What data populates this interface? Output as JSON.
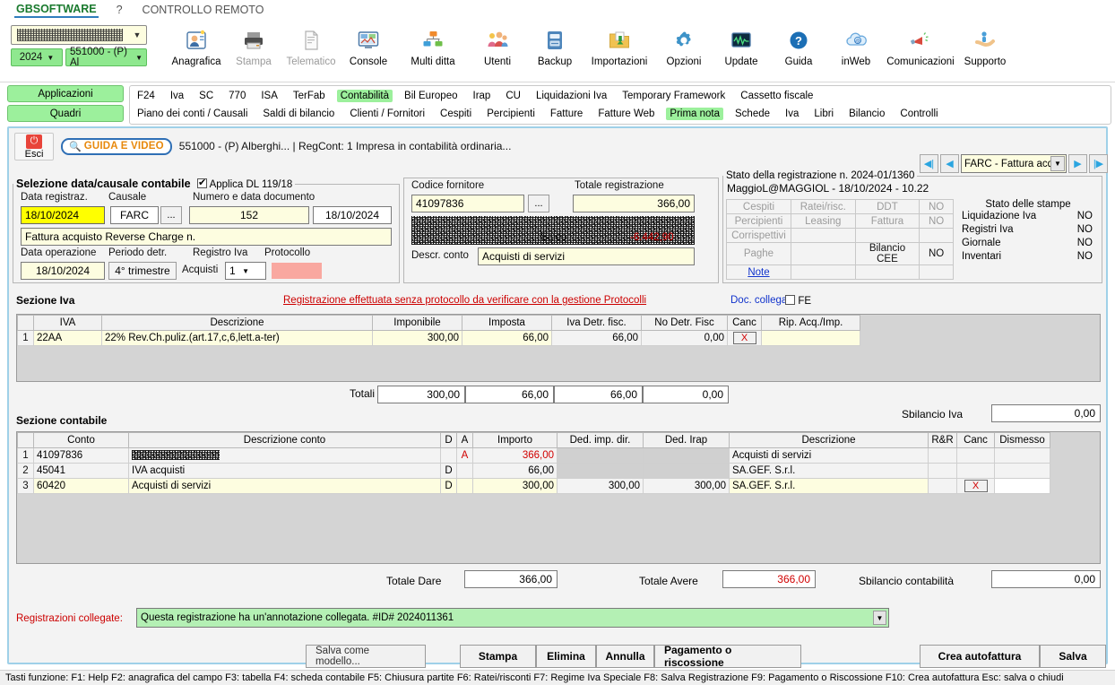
{
  "menubar": {
    "items": [
      {
        "label": "GBSOFTWARE",
        "active": true
      },
      {
        "label": "?",
        "active": false
      },
      {
        "label": "CONTROLLO REMOTO",
        "active": false
      }
    ]
  },
  "company": {
    "year": "2024",
    "code": "551000 - (P) Al",
    "name_redacted": ""
  },
  "toolbar": {
    "items": [
      {
        "label": "Anagrafica",
        "icon": "id-card-icon",
        "dim": false
      },
      {
        "label": "Stampa",
        "icon": "printer-icon",
        "dim": true
      },
      {
        "label": "Telematico",
        "icon": "document-icon",
        "dim": true
      },
      {
        "label": "Console",
        "icon": "monitor-icon",
        "dim": false
      },
      {
        "label": "Multi ditta",
        "icon": "org-chart-icon",
        "dim": false
      },
      {
        "label": "Utenti",
        "icon": "users-icon",
        "dim": false
      },
      {
        "label": "Backup",
        "icon": "backup-icon",
        "dim": false
      },
      {
        "label": "Importazioni",
        "icon": "import-folder-icon",
        "dim": false
      },
      {
        "label": "Opzioni",
        "icon": "gear-icon",
        "dim": false
      },
      {
        "label": "Update",
        "icon": "update-monitor-icon",
        "dim": false
      },
      {
        "label": "Guida",
        "icon": "help-icon",
        "dim": false
      },
      {
        "label": "inWeb",
        "icon": "cloud-icon",
        "dim": false
      },
      {
        "label": "Comunicazioni",
        "icon": "megaphone-icon",
        "dim": false
      },
      {
        "label": "Supporto",
        "icon": "support-hand-icon",
        "dim": false
      }
    ]
  },
  "nav": {
    "left_buttons": [
      "Applicazioni",
      "Quadri"
    ],
    "row1": [
      {
        "label": "F24",
        "selected": false
      },
      {
        "label": "Iva",
        "selected": false
      },
      {
        "label": "SC",
        "selected": false
      },
      {
        "label": "770",
        "selected": false
      },
      {
        "label": "ISA",
        "selected": false
      },
      {
        "label": "TerFab",
        "selected": false
      },
      {
        "label": "Contabilità",
        "selected": true
      },
      {
        "label": "Bil Europeo",
        "selected": false
      },
      {
        "label": "Irap",
        "selected": false
      },
      {
        "label": "CU",
        "selected": false
      },
      {
        "label": "Liquidazioni Iva",
        "selected": false
      },
      {
        "label": "Temporary Framework",
        "selected": false
      },
      {
        "label": "Cassetto fiscale",
        "selected": false
      }
    ],
    "row2": [
      {
        "label": "Piano dei conti / Causali",
        "selected": false
      },
      {
        "label": "Saldi di bilancio",
        "selected": false
      },
      {
        "label": "Clienti / Fornitori",
        "selected": false
      },
      {
        "label": "Cespiti",
        "selected": false
      },
      {
        "label": "Percipienti",
        "selected": false
      },
      {
        "label": "Fatture",
        "selected": false
      },
      {
        "label": "Fatture Web",
        "selected": false
      },
      {
        "label": "Prima nota",
        "selected": true
      },
      {
        "label": "Schede",
        "selected": false
      },
      {
        "label": "Iva",
        "selected": false
      },
      {
        "label": "Libri",
        "selected": false
      },
      {
        "label": "Bilancio",
        "selected": false
      },
      {
        "label": "Controlli",
        "selected": false
      }
    ]
  },
  "panel_header": {
    "exit_label": "Esci",
    "guide_label": "GUIDA E VIDEO",
    "title": "551000 - (P) Alberghi... | RegCont: 1 Impresa  in contabilità ordinaria..."
  },
  "record_nav": {
    "selected": "FARC - Fattura acq",
    "first_label": "⏮",
    "prev_label": "◀",
    "next_label": "▶",
    "last_label": "⏭"
  },
  "selezione": {
    "legend": "Selezione data/causale contabile",
    "checkbox_label": "Applica DL 119/18",
    "checkbox_checked": true,
    "label_data_registraz": "Data registraz.",
    "value_data_registraz": "18/10/2024",
    "label_causale": "Causale",
    "value_causale": "FARC",
    "causale_browse": "...",
    "label_numero_data_doc": "Numero e data documento",
    "value_numero_doc": "152",
    "value_data_doc": "18/10/2024",
    "value_descrizione": "Fattura acquisto Reverse Charge n.",
    "label_data_operazione": "Data operazione",
    "value_data_operazione": "18/10/2024",
    "label_periodo_detr": "Periodo detr.",
    "value_periodo_detr": "4° trimestre",
    "label_registro_iva": "Registro Iva",
    "value_registro_iva_tipo": "Acquisti",
    "value_registro_iva_num": "1",
    "label_protocollo": "Protocollo",
    "value_protocollo": ""
  },
  "fornitore": {
    "label_codice": "Codice fornitore",
    "value_codice": "41097836",
    "browse": "...",
    "label_totale": "Totale registrazione",
    "value_totale": "366,00",
    "label_saldo": "Saldo",
    "value_saldo": "-6.442,90",
    "label_descr_conto": "Descr. conto",
    "value_descr_conto": "Acquisti di servizi"
  },
  "stato": {
    "legend": "Stato della registrazione n. 2024-01/1360",
    "user_line": "MaggioL@MAGGIOL - 18/10/2024 - 10.22",
    "grid": [
      [
        "Cespiti",
        "Ratei/risc.",
        "DDT",
        "NO"
      ],
      [
        "Percipienti",
        "Leasing",
        "Fattura",
        "NO"
      ],
      [
        "Corrispettivi",
        "",
        "",
        ""
      ],
      [
        "Paghe",
        "",
        "Bilancio CEE",
        "NO"
      ],
      [
        "Note",
        "",
        "",
        ""
      ]
    ],
    "stampe_header": "Stato delle stampe",
    "stampe": [
      {
        "label": "Liquidazione Iva",
        "value": "NO"
      },
      {
        "label": "Registri Iva",
        "value": "NO"
      },
      {
        "label": "Giornale",
        "value": "NO"
      },
      {
        "label": "Inventari",
        "value": "NO"
      }
    ]
  },
  "sezione_iva": {
    "title": "Sezione Iva",
    "warning": "Registrazione effettuata senza protocollo da verificare con la gestione Protocolli",
    "doc_collegati_label": "Doc. collegati",
    "fe_label": "FE",
    "fe_checked": false,
    "headers": [
      "",
      "IVA",
      "Descrizione",
      "Imponibile",
      "Imposta",
      "Iva Detr. fisc.",
      "No Detr. Fisc",
      "Canc",
      "Rip. Acq./Imp."
    ],
    "rows": [
      {
        "idx": "1",
        "iva": "22AA",
        "descrizione": "22% Rev.Ch.puliz.(art.17,c,6,lett.a-ter)",
        "imponibile": "300,00",
        "imposta": "66,00",
        "iva_detr_fisc": "66,00",
        "no_detr_fisc": "0,00",
        "canc": "X",
        "rip": ""
      }
    ],
    "totali_label": "Totali",
    "totali": [
      "300,00",
      "66,00",
      "66,00",
      "0,00"
    ],
    "sbilancio_label": "Sbilancio Iva",
    "sbilancio_value": "0,00"
  },
  "sezione_contabile": {
    "title": "Sezione contabile",
    "headers": [
      "",
      "Conto",
      "Descrizione conto",
      "D",
      "A",
      "Importo",
      "Ded. imp. dir.",
      "Ded. Irap",
      "Descrizione",
      "R&R",
      "Canc",
      "Dismesso"
    ],
    "rows": [
      {
        "idx": "1",
        "conto": "41097836",
        "descrizione_conto": "",
        "redacted": true,
        "d": "",
        "a": "A",
        "importo": "366,00",
        "importo_red": true,
        "ded_imp_dir": "",
        "ded_irap": "",
        "descrizione": "Acquisti di servizi",
        "rr": "",
        "canc": "",
        "dismesso": ""
      },
      {
        "idx": "2",
        "conto": "45041",
        "descrizione_conto": "IVA acquisti",
        "redacted": false,
        "d": "D",
        "a": "",
        "importo": "66,00",
        "importo_red": false,
        "ded_imp_dir": "",
        "ded_irap": "",
        "descrizione": "SA.GEF. S.r.l.",
        "rr": "",
        "canc": "",
        "dismesso": ""
      },
      {
        "idx": "3",
        "conto": "60420",
        "descrizione_conto": "Acquisti di servizi",
        "redacted": false,
        "d": "D",
        "a": "",
        "importo": "300,00",
        "importo_red": false,
        "ded_imp_dir": "300,00",
        "ded_irap": "300,00",
        "descrizione": "SA.GEF. S.r.l.",
        "rr": "",
        "canc": "X",
        "dismesso": ""
      }
    ],
    "totale_dare_label": "Totale Dare",
    "totale_dare": "366,00",
    "totale_avere_label": "Totale Avere",
    "totale_avere": "366,00",
    "sbilancio_label": "Sbilancio contabilità",
    "sbilancio_value": "0,00"
  },
  "registrazioni_collegate": {
    "label": "Registrazioni collegate:",
    "value": "Questa registrazione ha un'annotazione collegata. #ID# 2024011361"
  },
  "bottom_buttons": [
    {
      "label": "Salva come modello...",
      "style": "plain"
    },
    {
      "label": "Stampa",
      "style": "bold"
    },
    {
      "label": "Elimina",
      "style": "bold"
    },
    {
      "label": "Annulla",
      "style": "bold"
    },
    {
      "label": "Pagamento o riscossione",
      "style": "bold"
    },
    {
      "label": "Crea autofattura",
      "style": "bold"
    },
    {
      "label": "Salva",
      "style": "bold"
    }
  ],
  "statusbar": {
    "text": "Tasti funzione: F1: Help  F2: anagrafica del campo  F3: tabella  F4: scheda contabile F5: Chiusura partite  F6: Ratei/risconti  F7: Regime Iva Speciale F8: Salva Registrazione  F9: Pagamento o Riscossione F10: Crea autofattura  Esc: salva o chiudi"
  },
  "colors": {
    "accent_green": "#9cf09c",
    "warning_red": "#cc0000",
    "link_blue": "#1133cc",
    "panel_border": "#9fd0e8",
    "highlight_yellow": "#ffff00"
  }
}
